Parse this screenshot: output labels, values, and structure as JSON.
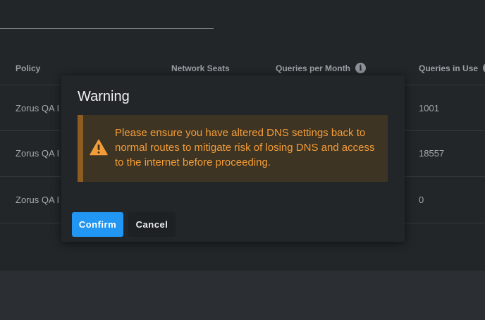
{
  "table": {
    "headers": {
      "policy": "Policy",
      "seats": "Network Seats",
      "queries_per_month": "Queries per Month",
      "queries_in_use": "Queries in Use"
    },
    "rows": [
      {
        "policy": "Zorus QA I",
        "queries_in_use": "1001"
      },
      {
        "policy": "Zorus QA I",
        "queries_in_use": "18557"
      },
      {
        "policy": "Zorus QA I",
        "queries_in_use": "0"
      }
    ]
  },
  "icons": {
    "info": "info-icon",
    "warning": "warning-icon"
  },
  "modal": {
    "title": "Warning",
    "message": "Please ensure you have altered DNS settings back to normal routes to mitigate risk of losing DNS and access to the internet before proceeding.",
    "confirm_label": "Confirm",
    "cancel_label": "Cancel"
  },
  "colors": {
    "primary": "#2196f3",
    "warning_text": "#f39c39",
    "warning_bg": "#3d3423",
    "warning_border": "#8c5c23",
    "modal_bg": "#222629"
  }
}
